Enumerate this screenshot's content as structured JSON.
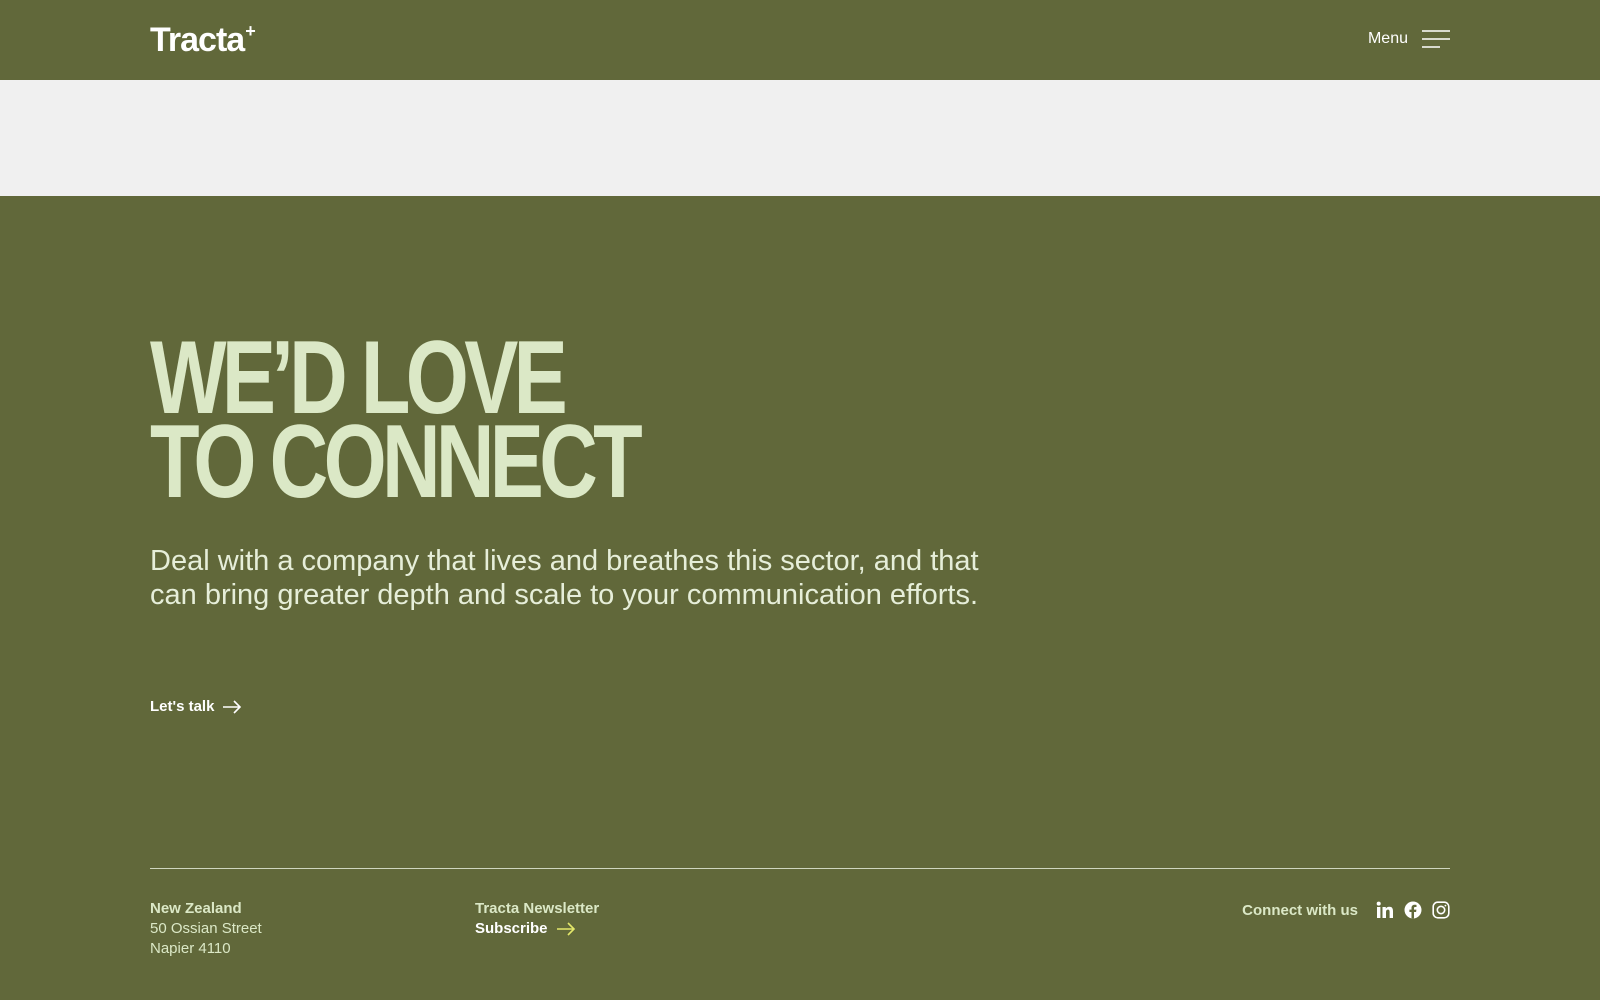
{
  "header": {
    "logo": "Tracta",
    "logo_mark": "+",
    "menu_label": "Menu",
    "menu_icon": "hamburger-icon"
  },
  "hero": {
    "headline_line1": "WE’D LOVE",
    "headline_line2": "TO CONNECT",
    "intro": "Deal with a company that lives and breathes this sector, and that can bring greater depth and scale to your communication efforts.",
    "cta_label": "Let's talk",
    "cta_icon": "arrow-right-icon"
  },
  "footer": {
    "address": {
      "title": "New Zealand",
      "line1": "50 Ossian Street",
      "line2": "Napier 4110"
    },
    "newsletter": {
      "title": "Tracta Newsletter",
      "subscribe_label": "Subscribe",
      "subscribe_icon": "arrow-right-icon"
    },
    "social": {
      "label": "Connect with us",
      "icons": [
        "linkedin-icon",
        "facebook-icon",
        "instagram-icon"
      ]
    }
  },
  "colors": {
    "background": "#61683a",
    "banner": "#f0f0f0",
    "headline": "#dbe8c6",
    "text_light": "#e6eed9",
    "accent_yellow": "#e4e86a"
  }
}
